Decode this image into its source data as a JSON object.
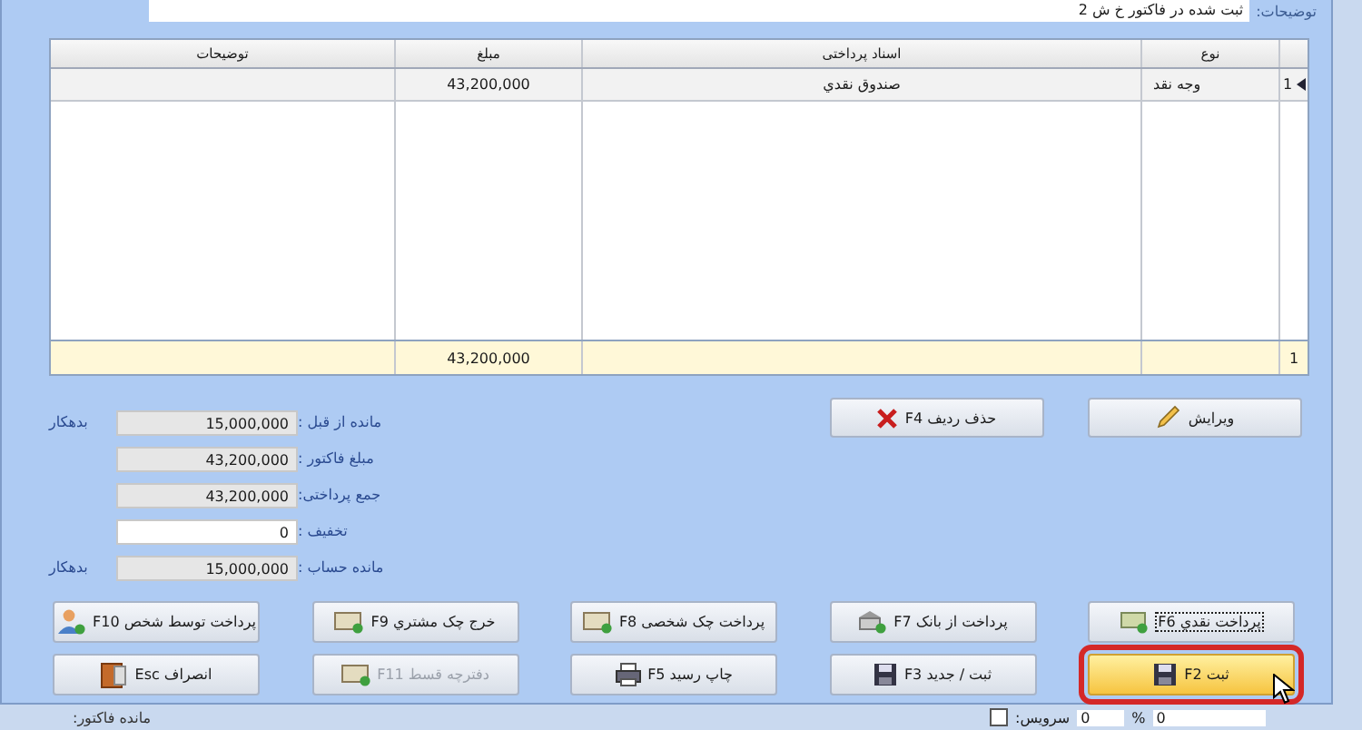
{
  "description": {
    "label": "توضیحات:",
    "value": "ثبت شده در فاکتور خ ش 2"
  },
  "table": {
    "columns": [
      "نوع",
      "اسناد پرداختی",
      "مبلغ",
      "توضیحات"
    ],
    "rows": [
      {
        "row_number": "1",
        "selected": true,
        "type": "وجه نقد",
        "document": "صندوق نقدي",
        "amount": "43,200,000"
      }
    ],
    "footer": {
      "row_number": "1",
      "amount": "43,200,000"
    }
  },
  "actions": [
    {
      "label": "ویرایش"
    },
    {
      "label": "حذف ردیف F4"
    }
  ],
  "summary": [
    {
      "label": "مانده از قبل :",
      "value": "15,000,000",
      "editable": false,
      "status": "بدهکار"
    },
    {
      "label": "مبلغ فاکتور :",
      "value": "43,200,000",
      "editable": false
    },
    {
      "label": "جمع پرداختی:",
      "value": "43,200,000",
      "editable": false
    },
    {
      "label": "تخفیف :",
      "value": "0",
      "editable": true
    },
    {
      "label": "مانده حساب :",
      "value": "15,000,000",
      "editable": false,
      "status": "بدهکار"
    }
  ],
  "button_rows": [
    [
      {
        "label": "پرداخت نقدي F6",
        "disabled": false,
        "highlighted": false,
        "focused": true
      },
      {
        "label": "پرداخت از بانک F7",
        "disabled": false,
        "highlighted": false,
        "focused": false
      },
      {
        "label": "پرداخت چک شخصی F8",
        "disabled": false,
        "highlighted": false,
        "focused": false
      },
      {
        "label": "خرج چک مشتري F9",
        "disabled": false,
        "highlighted": false,
        "focused": false
      },
      {
        "label": "پرداخت توسط شخص F10",
        "disabled": false,
        "highlighted": false,
        "focused": false
      }
    ],
    [
      {
        "label": "ثبت F2",
        "disabled": false,
        "highlighted": true,
        "focused": false
      },
      {
        "label": "ثبت / جدید F3",
        "disabled": false,
        "highlighted": false,
        "focused": false
      },
      {
        "label": "چاپ رسید F5",
        "disabled": false,
        "highlighted": false,
        "focused": false
      },
      {
        "label": "دفترچه قسط F11",
        "disabled": true,
        "highlighted": false,
        "focused": false
      },
      {
        "label": "انصراف Esc",
        "disabled": false,
        "highlighted": false,
        "focused": false
      }
    ]
  ],
  "background": {
    "left_label": "مانده فاکتور:",
    "right_label": "سرویس:",
    "percent": "%",
    "value_1": "0",
    "value_2": "0",
    "service_checked": false
  }
}
